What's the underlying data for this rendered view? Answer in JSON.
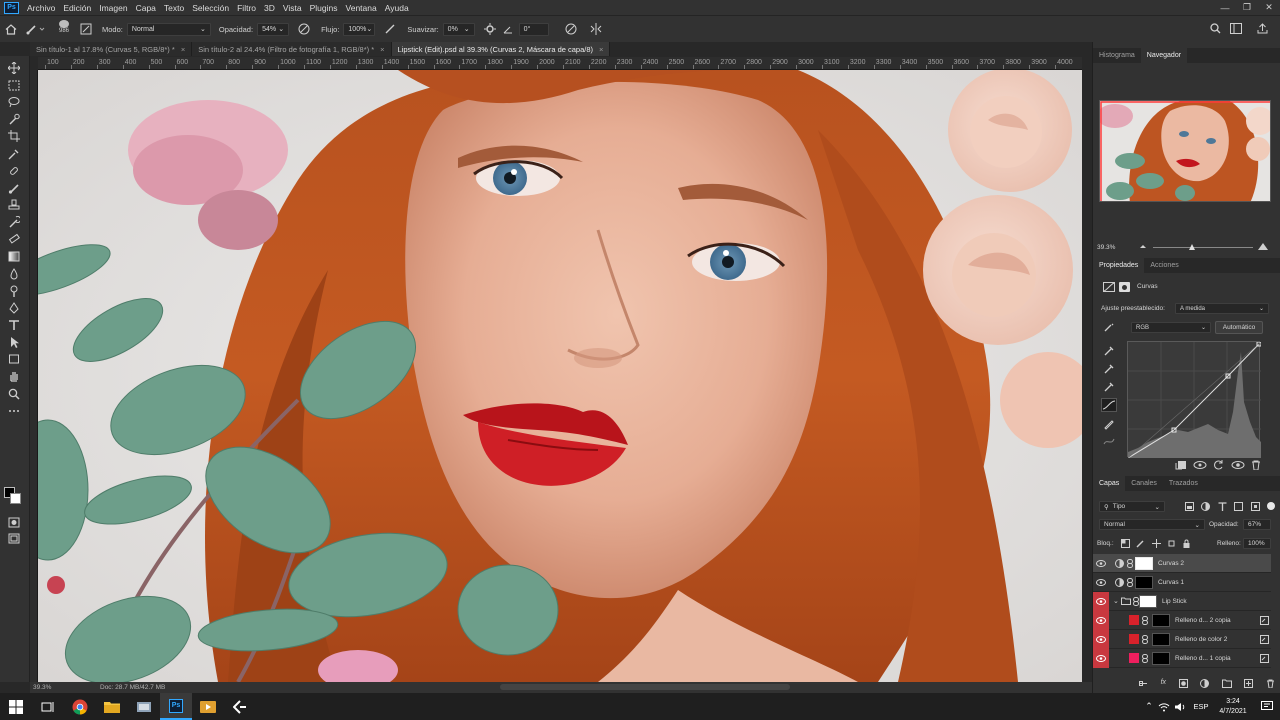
{
  "app": {
    "logo_text": "Ps"
  },
  "menu": [
    "Archivo",
    "Edición",
    "Imagen",
    "Capa",
    "Texto",
    "Selección",
    "Filtro",
    "3D",
    "Vista",
    "Plugins",
    "Ventana",
    "Ayuda"
  ],
  "options": {
    "brush_size": "986",
    "mode_label": "Modo:",
    "mode_value": "Normal",
    "opacity_label": "Opacidad:",
    "opacity_value": "54%",
    "flow_label": "Flujo:",
    "flow_value": "100%",
    "smooth_label": "Suavizar:",
    "smooth_value": "0%",
    "angle_value": "0°"
  },
  "tabs": [
    {
      "label": "Sin título-1 al 17.8% (Curvas 5, RGB/8*) *",
      "active": false
    },
    {
      "label": "Sin título-2 al 24.4% (Filtro de fotografía 1, RGB/8*) *",
      "active": false
    },
    {
      "label": "Lipstick (Edit).psd al 39.3% (Curvas 2, Máscara de capa/8)",
      "active": true
    }
  ],
  "ruler_ticks": [
    "100",
    "200",
    "300",
    "400",
    "500",
    "600",
    "700",
    "800",
    "900",
    "1000",
    "1100",
    "1200",
    "1300",
    "1400",
    "1500",
    "1600",
    "1700",
    "1800",
    "1900",
    "2000",
    "2100",
    "2200",
    "2300",
    "2400",
    "2500",
    "2600",
    "2700",
    "2800",
    "2900",
    "3000",
    "3100",
    "3200",
    "3300",
    "3400",
    "3500",
    "3600",
    "3700",
    "3800",
    "3900",
    "4000"
  ],
  "status": {
    "zoom": "39.3%",
    "doc": "Doc: 28.7 MB/42.7 MB"
  },
  "navigator": {
    "tabs": [
      "Histograma",
      "Navegador"
    ],
    "zoom": "39.3%"
  },
  "properties": {
    "tabs": [
      "Propiedades",
      "Acciones"
    ],
    "title": "Curvas",
    "preset_label": "Ajuste preestablecido:",
    "preset_value": "A medida",
    "channel_value": "RGB",
    "auto_label": "Automático"
  },
  "layers_panel": {
    "tabs": [
      "Capas",
      "Canales",
      "Trazados"
    ],
    "filter_value": "Tipo",
    "blend_value": "Normal",
    "opacity_label": "Opacidad:",
    "opacity_value": "67%",
    "lock_label": "Bloq.:",
    "fill_label": "Relleno:",
    "fill_value": "100%",
    "layers": [
      {
        "name": "Curvas 2",
        "type": "curves",
        "selected": true
      },
      {
        "name": "Curvas 1",
        "type": "curves",
        "selected": false
      },
      {
        "name": "Lip Stick",
        "type": "group",
        "selected": false
      },
      {
        "name": "Relleno d... 2 copia",
        "type": "fill",
        "selected": false
      },
      {
        "name": "Relleno de color 2",
        "type": "fill",
        "selected": false
      },
      {
        "name": "Relleno d... 1 copia",
        "type": "fill",
        "selected": false
      }
    ],
    "colors": {
      "eye_red": "#c9383f",
      "fill_red": "#d8222b",
      "fill_pink": "#ee1f5e"
    }
  },
  "taskbar": {
    "lang": "ESP",
    "time": "3:24",
    "date": "4/7/2021"
  },
  "colors": {
    "ps_blue": "#31a8ff",
    "panel_bg": "#323232",
    "hair": "#b6491e"
  }
}
